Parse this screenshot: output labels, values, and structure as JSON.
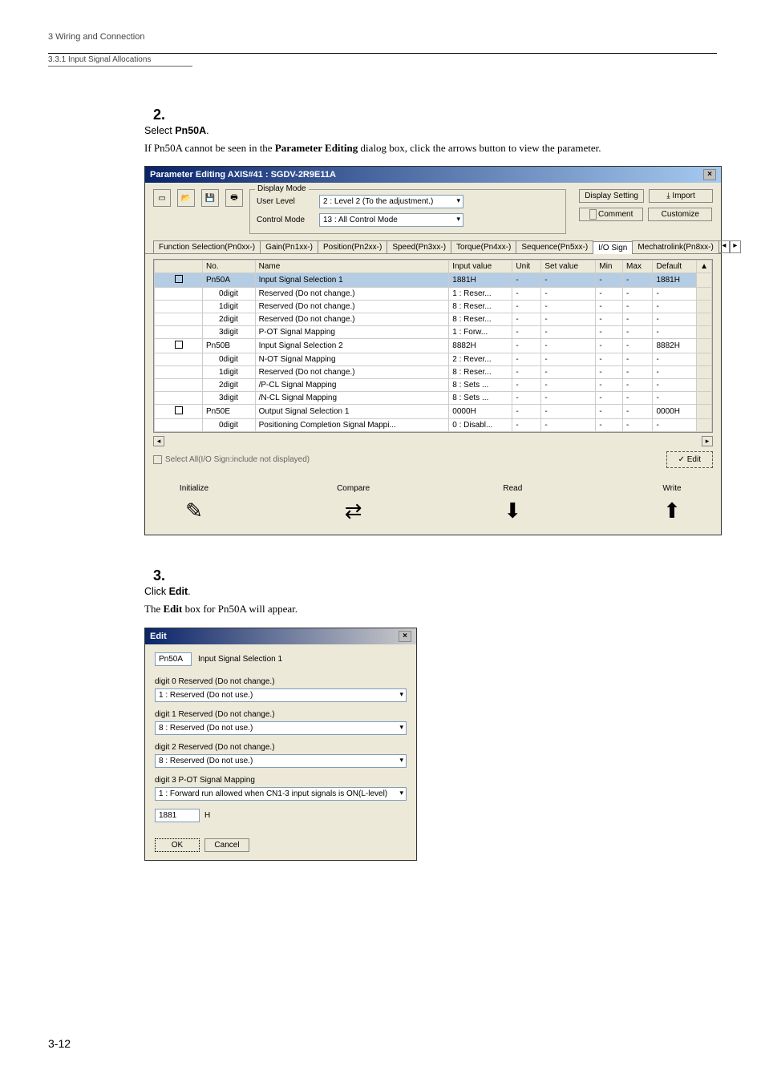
{
  "header": {
    "chapter": "3  Wiring and Connection",
    "section": "3.3.1  Input Signal Allocations"
  },
  "step2": {
    "number": "2.",
    "title_prefix": "Select ",
    "title_bold": "Pn50A",
    "title_suffix": ".",
    "desc_prefix": "If Pn50A cannot be seen in the ",
    "desc_bold": "Parameter Editing",
    "desc_suffix": " dialog box, click the arrows button to view the parameter."
  },
  "dialog1": {
    "title": "Parameter Editing AXIS#41 : SGDV-2R9E11A",
    "display_mode_legend": "Display Mode",
    "user_level_label": "User Level",
    "user_level_value": "2 : Level 2 (To the adjustment.)",
    "control_mode_label": "Control Mode",
    "control_mode_value": "13 : All Control Mode",
    "display_setting_btn": "Display Setting",
    "import_btn": "Import",
    "comment_btn": "Comment",
    "customize_btn": "Customize",
    "tabs": [
      "Function Selection(Pn0xx-)",
      "Gain(Pn1xx-)",
      "Position(Pn2xx-)",
      "Speed(Pn3xx-)",
      "Torque(Pn4xx-)",
      "Sequence(Pn5xx-)",
      "I/O Sign",
      "Mechatrolink(Pn8xx-)"
    ],
    "selected_tab_index": 6,
    "columns": [
      "No.",
      "Name",
      "Input value",
      "Unit",
      "Set value",
      "Min",
      "Max",
      "Default"
    ],
    "rows": [
      {
        "no": "Pn50A",
        "name": "Input Signal Selection 1",
        "input": "1881H",
        "unit": "-",
        "set": "-",
        "min": "-",
        "max": "-",
        "def": "1881H",
        "box": true,
        "hl": true
      },
      {
        "no": "0digit",
        "name": "Reserved (Do not change.)",
        "input": "1 : Reser...",
        "unit": "-",
        "set": "-",
        "min": "-",
        "max": "-",
        "def": "-"
      },
      {
        "no": "1digit",
        "name": "Reserved (Do not change.)",
        "input": "8 : Reser...",
        "unit": "-",
        "set": "-",
        "min": "-",
        "max": "-",
        "def": "-"
      },
      {
        "no": "2digit",
        "name": "Reserved (Do not change.)",
        "input": "8 : Reser...",
        "unit": "-",
        "set": "-",
        "min": "-",
        "max": "-",
        "def": "-"
      },
      {
        "no": "3digit",
        "name": "P-OT Signal Mapping",
        "input": "1 : Forw...",
        "unit": "-",
        "set": "-",
        "min": "-",
        "max": "-",
        "def": "-"
      },
      {
        "no": "Pn50B",
        "name": "Input Signal Selection 2",
        "input": "8882H",
        "unit": "-",
        "set": "-",
        "min": "-",
        "max": "-",
        "def": "8882H",
        "box": true
      },
      {
        "no": "0digit",
        "name": "N-OT Signal Mapping",
        "input": "2 : Rever...",
        "unit": "-",
        "set": "-",
        "min": "-",
        "max": "-",
        "def": "-"
      },
      {
        "no": "1digit",
        "name": "Reserved (Do not change.)",
        "input": "8 : Reser...",
        "unit": "-",
        "set": "-",
        "min": "-",
        "max": "-",
        "def": "-"
      },
      {
        "no": "2digit",
        "name": "/P-CL Signal Mapping",
        "input": "8 : Sets ...",
        "unit": "-",
        "set": "-",
        "min": "-",
        "max": "-",
        "def": "-"
      },
      {
        "no": "3digit",
        "name": "/N-CL Signal Mapping",
        "input": "8 : Sets ...",
        "unit": "-",
        "set": "-",
        "min": "-",
        "max": "-",
        "def": "-"
      },
      {
        "no": "Pn50E",
        "name": "Output Signal Selection 1",
        "input": "0000H",
        "unit": "-",
        "set": "-",
        "min": "-",
        "max": "-",
        "def": "0000H",
        "box": true
      },
      {
        "no": "0digit",
        "name": "Positioning Completion Signal Mappi...",
        "input": "0 : Disabl...",
        "unit": "-",
        "set": "-",
        "min": "-",
        "max": "-",
        "def": "-"
      }
    ],
    "select_all_label": "Select All(I/O Sign:include not displayed)",
    "edit_btn": "✓ Edit",
    "initialize_btn": "Initialize",
    "compare_btn": "Compare",
    "read_btn": "Read",
    "write_btn": "Write"
  },
  "step3": {
    "number": "3.",
    "title_prefix": "Click ",
    "title_bold": "Edit",
    "title_suffix": ".",
    "desc_prefix": "The ",
    "desc_bold": "Edit",
    "desc_suffix": " box for Pn50A will appear."
  },
  "dialog2": {
    "title": "Edit",
    "param_no": "Pn50A",
    "param_name": "Input Signal Selection 1",
    "fields": [
      {
        "label": "digit 0  Reserved (Do not change.)",
        "value": "1 : Reserved (Do not use.)"
      },
      {
        "label": "digit 1  Reserved (Do not change.)",
        "value": "8 : Reserved (Do not use.)"
      },
      {
        "label": "digit 2  Reserved (Do not change.)",
        "value": "8 : Reserved (Do not use.)"
      },
      {
        "label": "digit 3  P-OT Signal Mapping",
        "value": "1 : Forward run allowed when CN1-3 input signals is ON(L-level)"
      }
    ],
    "hex_value": "1881",
    "hex_suffix": "H",
    "ok_btn": "OK",
    "cancel_btn": "Cancel"
  },
  "page_number": "3-12"
}
